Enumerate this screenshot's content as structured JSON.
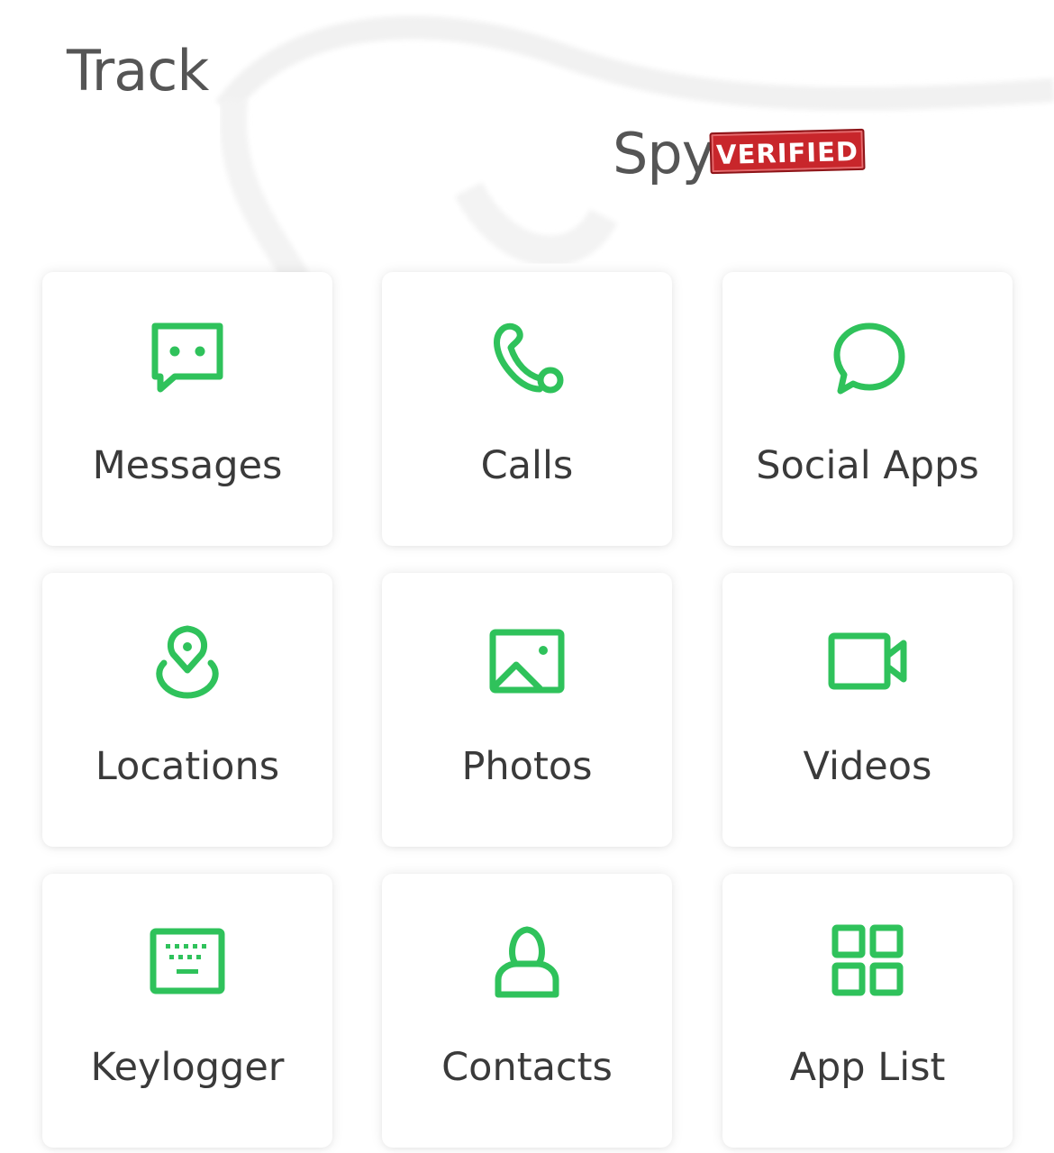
{
  "header": {
    "title_part1": "Track",
    "title_part2": "Spy",
    "stamp_text": "VERIFIED"
  },
  "colors": {
    "accent": "#2fc25b",
    "stamp_red": "#c8262b",
    "text": "#3a3a3a"
  },
  "tiles": [
    {
      "label": "Messages",
      "icon": "message-icon"
    },
    {
      "label": "Calls",
      "icon": "phone-icon"
    },
    {
      "label": "Social Apps",
      "icon": "chat-bubble-icon"
    },
    {
      "label": "Locations",
      "icon": "location-pin-icon"
    },
    {
      "label": "Photos",
      "icon": "image-icon"
    },
    {
      "label": "Videos",
      "icon": "video-camera-icon"
    },
    {
      "label": "Keylogger",
      "icon": "keyboard-icon"
    },
    {
      "label": "Contacts",
      "icon": "person-icon"
    },
    {
      "label": "App List",
      "icon": "app-grid-icon"
    }
  ]
}
